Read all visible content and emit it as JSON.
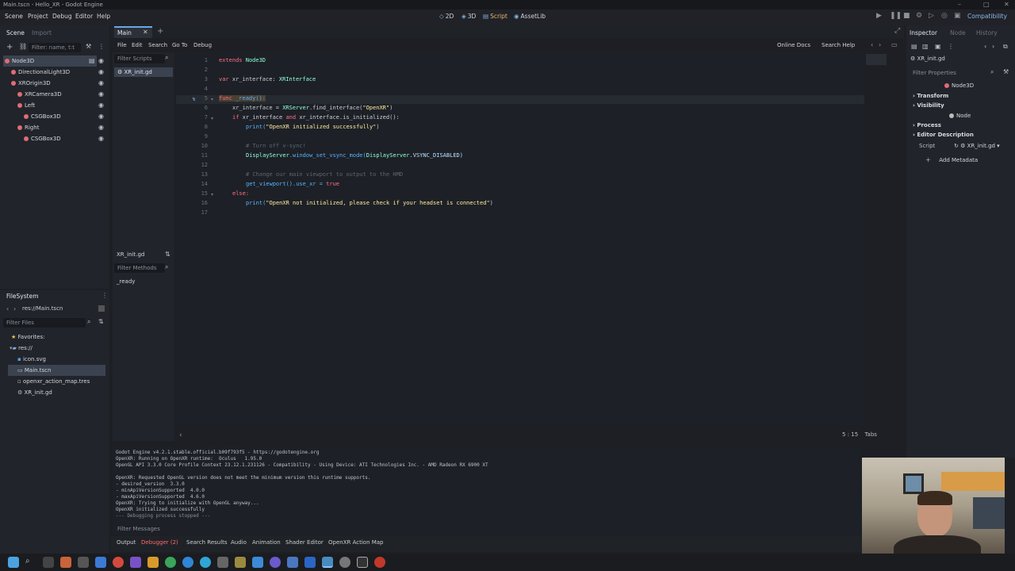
{
  "window": {
    "title": "Main.tscn - Hello_XR - Godot Engine"
  },
  "menus": [
    "Scene",
    "Project",
    "Debug",
    "Editor",
    "Help"
  ],
  "workspaces": [
    {
      "label": "2D",
      "icon": "2d-icon"
    },
    {
      "label": "3D",
      "icon": "3d-icon"
    },
    {
      "label": "Script",
      "icon": "script-icon",
      "active": true
    },
    {
      "label": "AssetLib",
      "icon": "assetlib-icon"
    }
  ],
  "renderer": "Compatibility",
  "scene_dock": {
    "tabs": [
      "Scene",
      "Import"
    ],
    "filter_placeholder": "Filter: name, t:t",
    "nodes": [
      {
        "label": "Node3D",
        "depth": 0
      },
      {
        "label": "DirectionalLight3D",
        "depth": 1
      },
      {
        "label": "XROrigin3D",
        "depth": 1
      },
      {
        "label": "XRCamera3D",
        "depth": 2
      },
      {
        "label": "Left",
        "depth": 2
      },
      {
        "label": "CSGBox3D",
        "depth": 3
      },
      {
        "label": "Right",
        "depth": 2
      },
      {
        "label": "CSGBox3D",
        "depth": 3
      }
    ]
  },
  "filesystem": {
    "title": "FileSystem",
    "path": "res://Main.tscn",
    "filter_placeholder": "Filter Files",
    "items": [
      {
        "label": "Favorites:"
      },
      {
        "label": "res://"
      },
      {
        "label": "icon.svg"
      },
      {
        "label": "Main.tscn"
      },
      {
        "label": "openxr_action_map.tres"
      },
      {
        "label": "XR_init.gd"
      }
    ]
  },
  "editor_tabs": {
    "main": "Main"
  },
  "script_menu": [
    "File",
    "Edit",
    "Search",
    "Go To",
    "Debug"
  ],
  "script_tools": {
    "online_docs": "Online Docs",
    "search_help": "Search Help"
  },
  "script_list": {
    "filter": "Filter Scripts",
    "item": "XR_init.gd",
    "methods_title": "XR_init.gd",
    "filter_methods": "Filter Methods",
    "methods": [
      "_ready"
    ]
  },
  "code": {
    "line_numbers": [
      "1",
      "2",
      "3",
      "4",
      "5",
      "6",
      "7",
      "8",
      "9",
      "10",
      "11",
      "12",
      "13",
      "14",
      "15",
      "16",
      "17"
    ],
    "lines": {
      "l1a": "extends",
      "l1b": "Node3D",
      "l3a": "var",
      "l3b": " xr_interface: ",
      "l3c": "XRInterface",
      "l5a": "func",
      "l5b": " _ready():",
      "l6a": "xr_interface = ",
      "l6b": "XRServer",
      "l6c": ".find_interface(",
      "l6d": "\"OpenXR\"",
      "l6e": ")",
      "l7a": "if",
      "l7b": " xr_interface ",
      "l7c": "and",
      "l7d": " xr_interface.is_initialized():",
      "l8a": "print(",
      "l8b": "\"OpenXR initialized successfully\"",
      "l8c": ")",
      "l10": "# Turn off v-sync!",
      "l11a": "DisplayServer",
      "l11b": ".window_set_vsync_mode(",
      "l11c": "DisplayServer",
      "l11d": ".VSYNC_DISABLED)",
      "l13": "# Change our main viewport to output to the HMD",
      "l14a": "get_viewport().use_xr = ",
      "l14b": "true",
      "l15": "else:",
      "l16a": "print(",
      "l16b": "\"OpenXR not initialized, please check if your headset is connected\"",
      "l16c": ")"
    },
    "status": {
      "line": "5",
      "col": "15",
      "indent": "Tabs"
    }
  },
  "console": {
    "lines": [
      "Godot Engine v4.2.1.stable.official.b09f793f5 - https://godotengine.org",
      "OpenXR: Running on OpenXR runtime:  Oculus   1.95.0",
      "OpenGL API 3.3.0 Core Profile Context 23.12.1.231126 - Compatibility - Using Device: ATI Technologies Inc. - AMD Radeon RX 6900 XT",
      "",
      "OpenXR: Requested OpenGL version does not meet the minimum version this runtime supports.",
      "- desired_version  3.3.0",
      "- minApiVersionSupported  4.0.0",
      "- maxApiVersionSupported  4.6.0",
      "OpenXR: Trying to initialize with OpenGL anyway...",
      "OpenXR initialized successfully",
      "--- Debugging process stopped ---"
    ],
    "filter": "Filter Messages"
  },
  "bottom_tabs": [
    "Output",
    "Debugger (2)",
    "Search Results",
    "Audio",
    "Animation",
    "Shader Editor",
    "OpenXR Action Map"
  ],
  "inspector": {
    "tabs": [
      "Inspector",
      "Node",
      "History"
    ],
    "file": "XR_init.gd",
    "filter": "Filter Properties",
    "class": "Node3D",
    "sections": [
      "Transform",
      "Visibility"
    ],
    "node_label": "Node",
    "sections2": [
      "Process",
      "Editor Description"
    ],
    "script_label": "Script",
    "script_value": "XR_init.gd",
    "add_metadata": "Add Metadata"
  }
}
